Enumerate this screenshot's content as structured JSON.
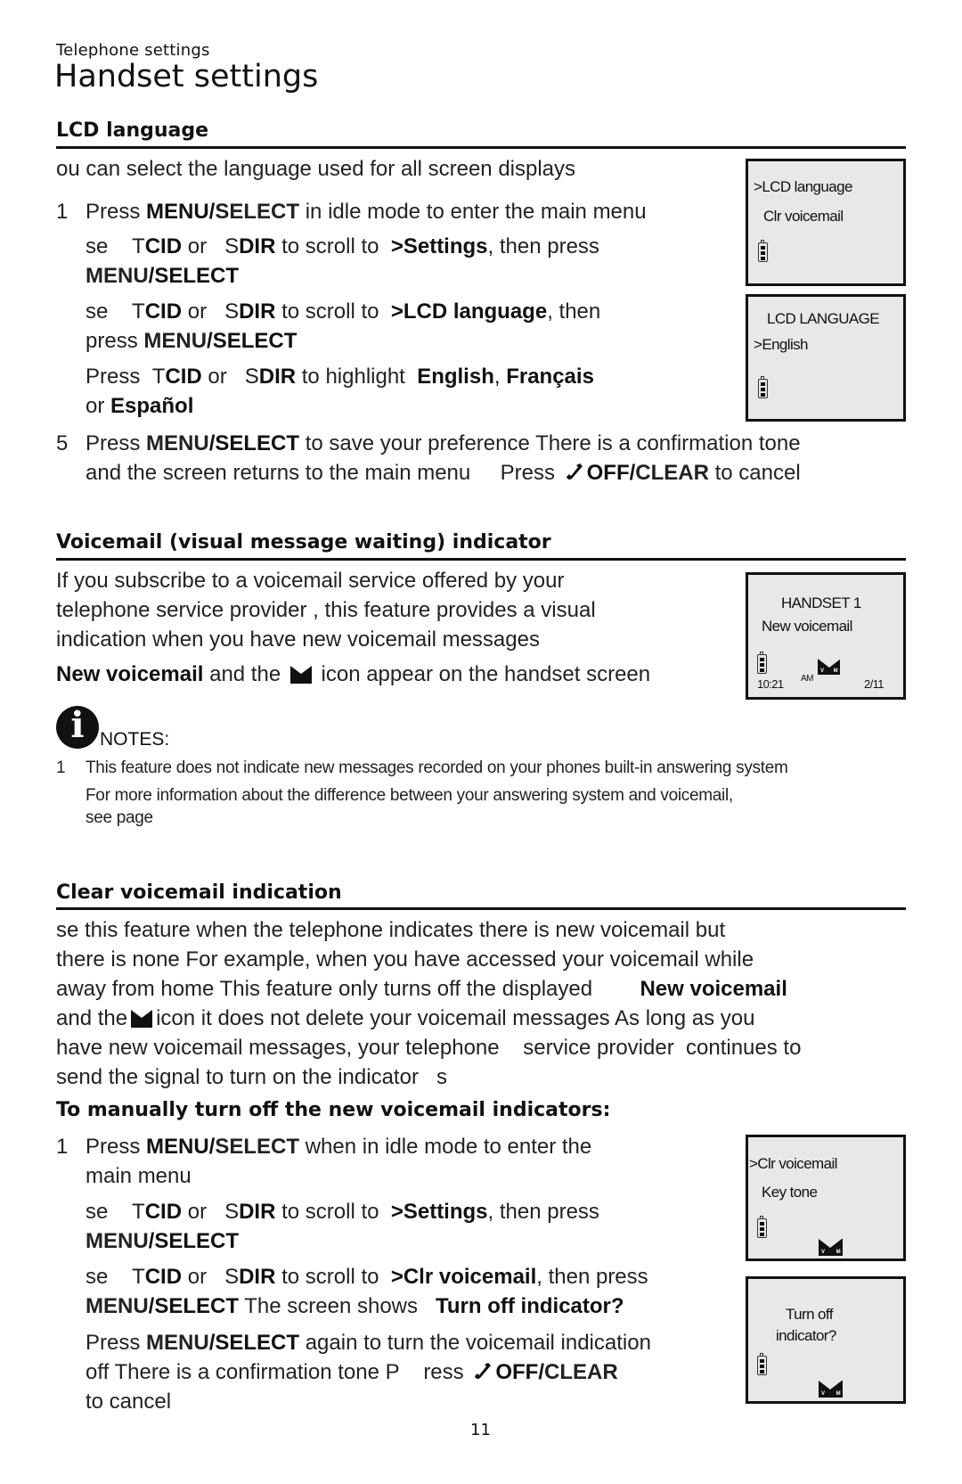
{
  "header": {
    "kicker": "Telephone settings",
    "title": "Handset settings"
  },
  "lcd_language": {
    "heading": "LCD language",
    "intro": "ou can select the language used for all screen displays",
    "steps": [
      {
        "num": "1",
        "parts": [
          "Press ",
          "MENU/",
          "SELECT",
          " in idle mode to enter the main menu"
        ]
      },
      {
        "num": "",
        "line1": [
          "se ",
          "T",
          "CID",
          " or ",
          "S",
          "DIR",
          " to scroll to ",
          ">Settings",
          ", then press"
        ],
        "line2": [
          "MENU",
          "/SELECT"
        ]
      },
      {
        "num": "",
        "line1": [
          "se ",
          "T",
          "CID",
          " or ",
          "S",
          "DIR",
          " to scroll to ",
          ">LCD language",
          ", then"
        ],
        "line2": [
          "press ",
          "MENU",
          "/SELECT"
        ]
      },
      {
        "num": "",
        "line1": [
          "Press ",
          "T",
          "CID",
          " or ",
          "S",
          "DIR",
          " to highlight ",
          "English",
          ", ",
          "Français"
        ],
        "line2": [
          "or ",
          "Español"
        ]
      },
      {
        "num": "5",
        "line1": [
          "Press ",
          "MENU",
          "/SELECT",
          " to save your preference There is a confirmation tone"
        ],
        "line2": [
          "and the screen returns to the main menu",
          "Press ",
          "OFF/",
          "CLEAR",
          " to cancel"
        ]
      }
    ],
    "screens": [
      {
        "line1": ">LCD language",
        "line2": "Clr voicemail"
      },
      {
        "line1": "LCD LANGUAGE",
        "line2": ">English"
      }
    ]
  },
  "voicemail": {
    "heading": "Voicemail (visual message waiting) indicator",
    "para": [
      "If you subscribe to a voicemail service offered by your",
      "telephone  service provider , this feature provides a visual",
      "indication when you have new voicemail messages"
    ],
    "icon_line": [
      "New voicemail",
      " and the ",
      " icon appear on the handset screen"
    ],
    "screen": {
      "line1": "HANDSET 1",
      "line2": "New voicemail",
      "time": "10:21",
      "ampm": "AM",
      "date": "2/11"
    },
    "notes_label": "NOTES:",
    "notes": [
      {
        "num": "1",
        "text": "This feature does not indicate new messages recorded on your phones built-in answering system"
      },
      {
        "num": "",
        "text": "For more information about the difference between your answering system and voicemail,"
      },
      {
        "num": "",
        "text": "see page"
      }
    ]
  },
  "clear_voicemail": {
    "heading": "Clear voicemail indication",
    "para": [
      "se this feature when the telephone indicates there is new voicemail but",
      "there is none For example, when you have accessed your voicemail while",
      "away from home This feature only turns off the displayed",
      "New voicemail",
      "and the",
      "icon it does not delete your voicemail messages As long as you",
      "have new voicemail messages, your telephone    service provider  continues to",
      "send the signal to turn on the indicator   s"
    ],
    "subheading": "To manually turn off the new voicemail indicators:",
    "steps": [
      {
        "num": "1",
        "line1": [
          "Press ",
          "MENU/",
          "SELECT",
          " when in idle mode to enter the"
        ],
        "line2": "main menu"
      },
      {
        "num": "",
        "line1": [
          "se ",
          "T",
          "CID",
          " or ",
          "S",
          "DIR",
          " to scroll to ",
          ">Settings",
          ", then press"
        ],
        "line2": [
          "MENU",
          "/SELECT"
        ]
      },
      {
        "num": "",
        "line1": [
          "se ",
          "T",
          "CID",
          " or ",
          "S",
          "DIR",
          " to scroll to ",
          ">Clr voicemail",
          ", then press"
        ],
        "line2": [
          "MENU",
          "/SELECT",
          " The screen shows ",
          "Turn off indicator?"
        ]
      },
      {
        "num": "",
        "line1": [
          "Press ",
          "MENU",
          "/SELECT",
          " again to turn the voicemail indication"
        ],
        "line2": [
          "off There is a confirmation tone P",
          "ress ",
          "OFF/",
          "CLEAR"
        ],
        "line3": "to cancel"
      }
    ],
    "screens": [
      {
        "line1": ">Clr voicemail",
        "line2": "Key tone"
      },
      {
        "line1": "Turn off",
        "line2": "indicator?"
      }
    ]
  },
  "page_number": "11",
  "icons": {
    "battery": "battery-icon",
    "voicemail": "voicemail-envelope-icon",
    "phone": "off-phone-icon",
    "info": "info-icon"
  }
}
